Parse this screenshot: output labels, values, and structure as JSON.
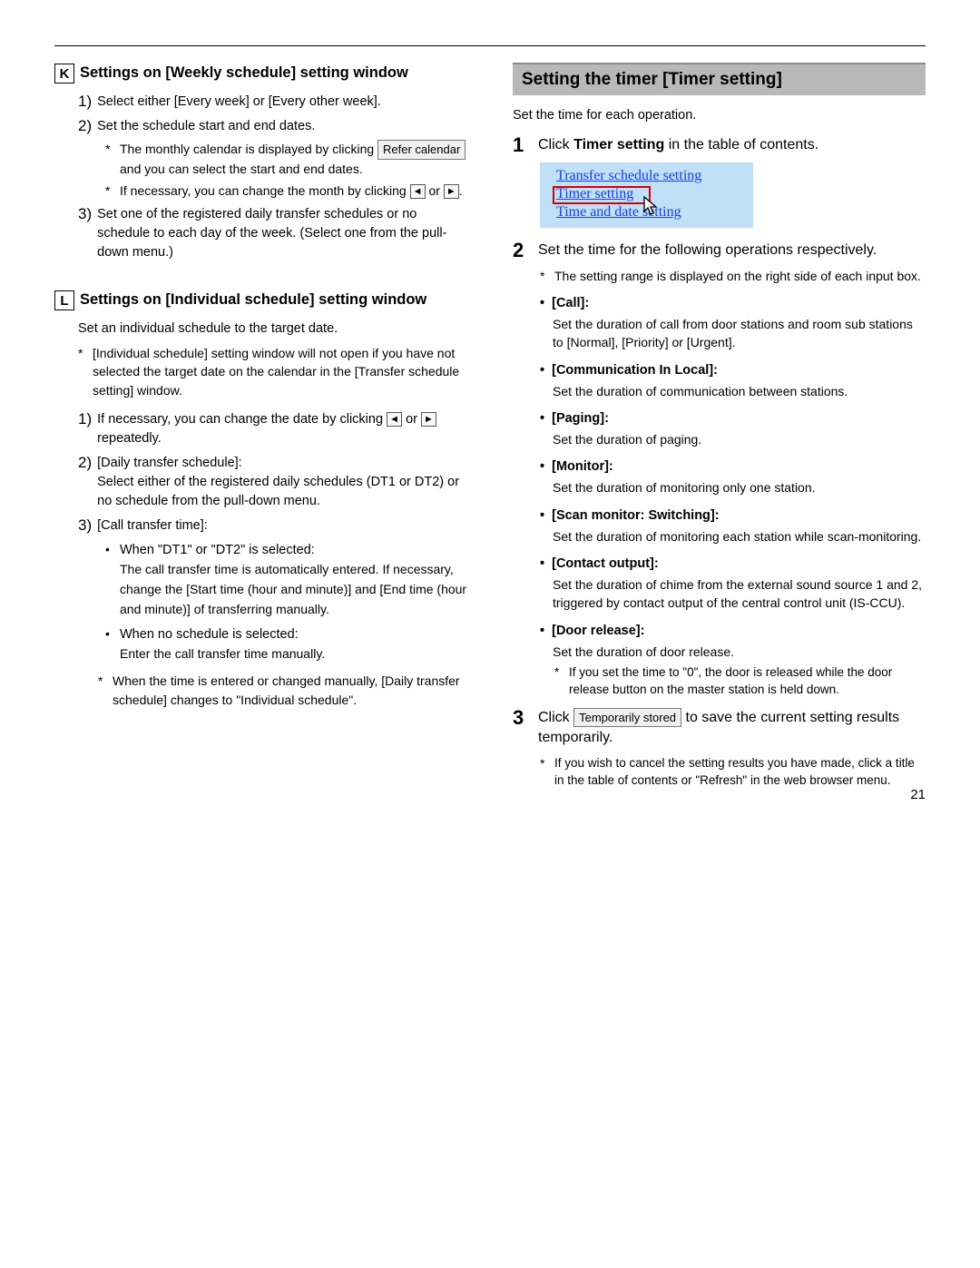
{
  "pageNumber": "21",
  "left": {
    "K": {
      "letter": "K",
      "title": "Settings on [Weekly schedule] setting window",
      "s1": {
        "num": "1)",
        "text": "Select either [Every week] or [Every other week]."
      },
      "s2": {
        "num": "2)",
        "text": "Set the schedule start and end dates.",
        "n1a": "The monthly calendar is displayed by clicking",
        "n1btn": "Refer calendar",
        "n1b": " and you can select the start and end dates.",
        "n2a": "If necessary, you can change the month by clicking ",
        "n2or": " or ",
        "n2end": "."
      },
      "s3": {
        "num": "3)",
        "text": "Set one of the registered daily transfer schedules or no schedule to each day of the week. (Select one from the pull-down menu.)"
      }
    },
    "L": {
      "letter": "L",
      "title": "Settings on [Individual schedule] setting window",
      "intro": "Set an individual schedule to the target date.",
      "note0": "[Individual schedule] setting window will not open if you have not selected the target date on the calendar in the [Transfer schedule setting] window.",
      "s1": {
        "num": "1)",
        "a": "If necessary, you can change the date by clicking ",
        "or": " or ",
        "b": " repeatedly."
      },
      "s2": {
        "num": "2)",
        "head": "[Daily transfer schedule]:",
        "text": "Select either of the registered daily schedules (DT1 or DT2) or no schedule from the pull-down menu."
      },
      "s3": {
        "num": "3)",
        "head": "[Call transfer time]:",
        "b1h": "When \"DT1\" or \"DT2\" is selected:",
        "b1t": "The call transfer time is automatically entered. If necessary, change the [Start time (hour and minute)] and [End time (hour and minute)] of transferring manually.",
        "b2h": "When no schedule is selected:",
        "b2t": "Enter the call transfer time manually.",
        "note": "When the time is entered or changed manually, [Daily transfer schedule] changes to \"Individual schedule\"."
      }
    }
  },
  "right": {
    "header": "Setting the timer [Timer setting]",
    "intro": "Set the time for each operation.",
    "s1": {
      "num": "1",
      "pre": "Click ",
      "bold": "Timer setting",
      "post": " in the table of contents.",
      "toc": {
        "a": "Transfer schedule setting",
        "b": "Timer setting",
        "c": "Time and date setting"
      }
    },
    "s2": {
      "num": "2",
      "text": "Set the time for the following operations respectively.",
      "note": "The setting range is displayed on the right side of each input box.",
      "items": {
        "call": {
          "head": "[Call]:",
          "desc": "Set the duration of call from door stations and room sub stations to [Normal], [Priority] or [Urgent]."
        },
        "comm": {
          "head": "[Communication In Local]:",
          "desc": "Set the duration of communication between stations."
        },
        "paging": {
          "head": "[Paging]:",
          "desc": "Set the duration of paging."
        },
        "monitor": {
          "head": "[Monitor]:",
          "desc": "Set the duration of monitoring only one station."
        },
        "scan": {
          "head": "[Scan monitor: Switching]:",
          "desc": "Set the duration of monitoring each station while scan-monitoring."
        },
        "contact": {
          "head": "[Contact output]:",
          "desc": "Set the duration of chime from the external sound source 1 and 2, triggered by contact output of the central control unit (IS-CCU)."
        },
        "door": {
          "head": "[Door release]:",
          "desc": "Set the duration of door release.",
          "sub": "If you set the time to \"0\", the door is released while the door release button on the master station is held down."
        }
      }
    },
    "s3": {
      "num": "3",
      "pre": "Click ",
      "btn": "Temporarily stored",
      "post": " to save the current setting results temporarily.",
      "note": "If you wish to cancel the setting results you have made, click a title in the table of contents or \"Refresh\" in the web browser menu."
    }
  }
}
